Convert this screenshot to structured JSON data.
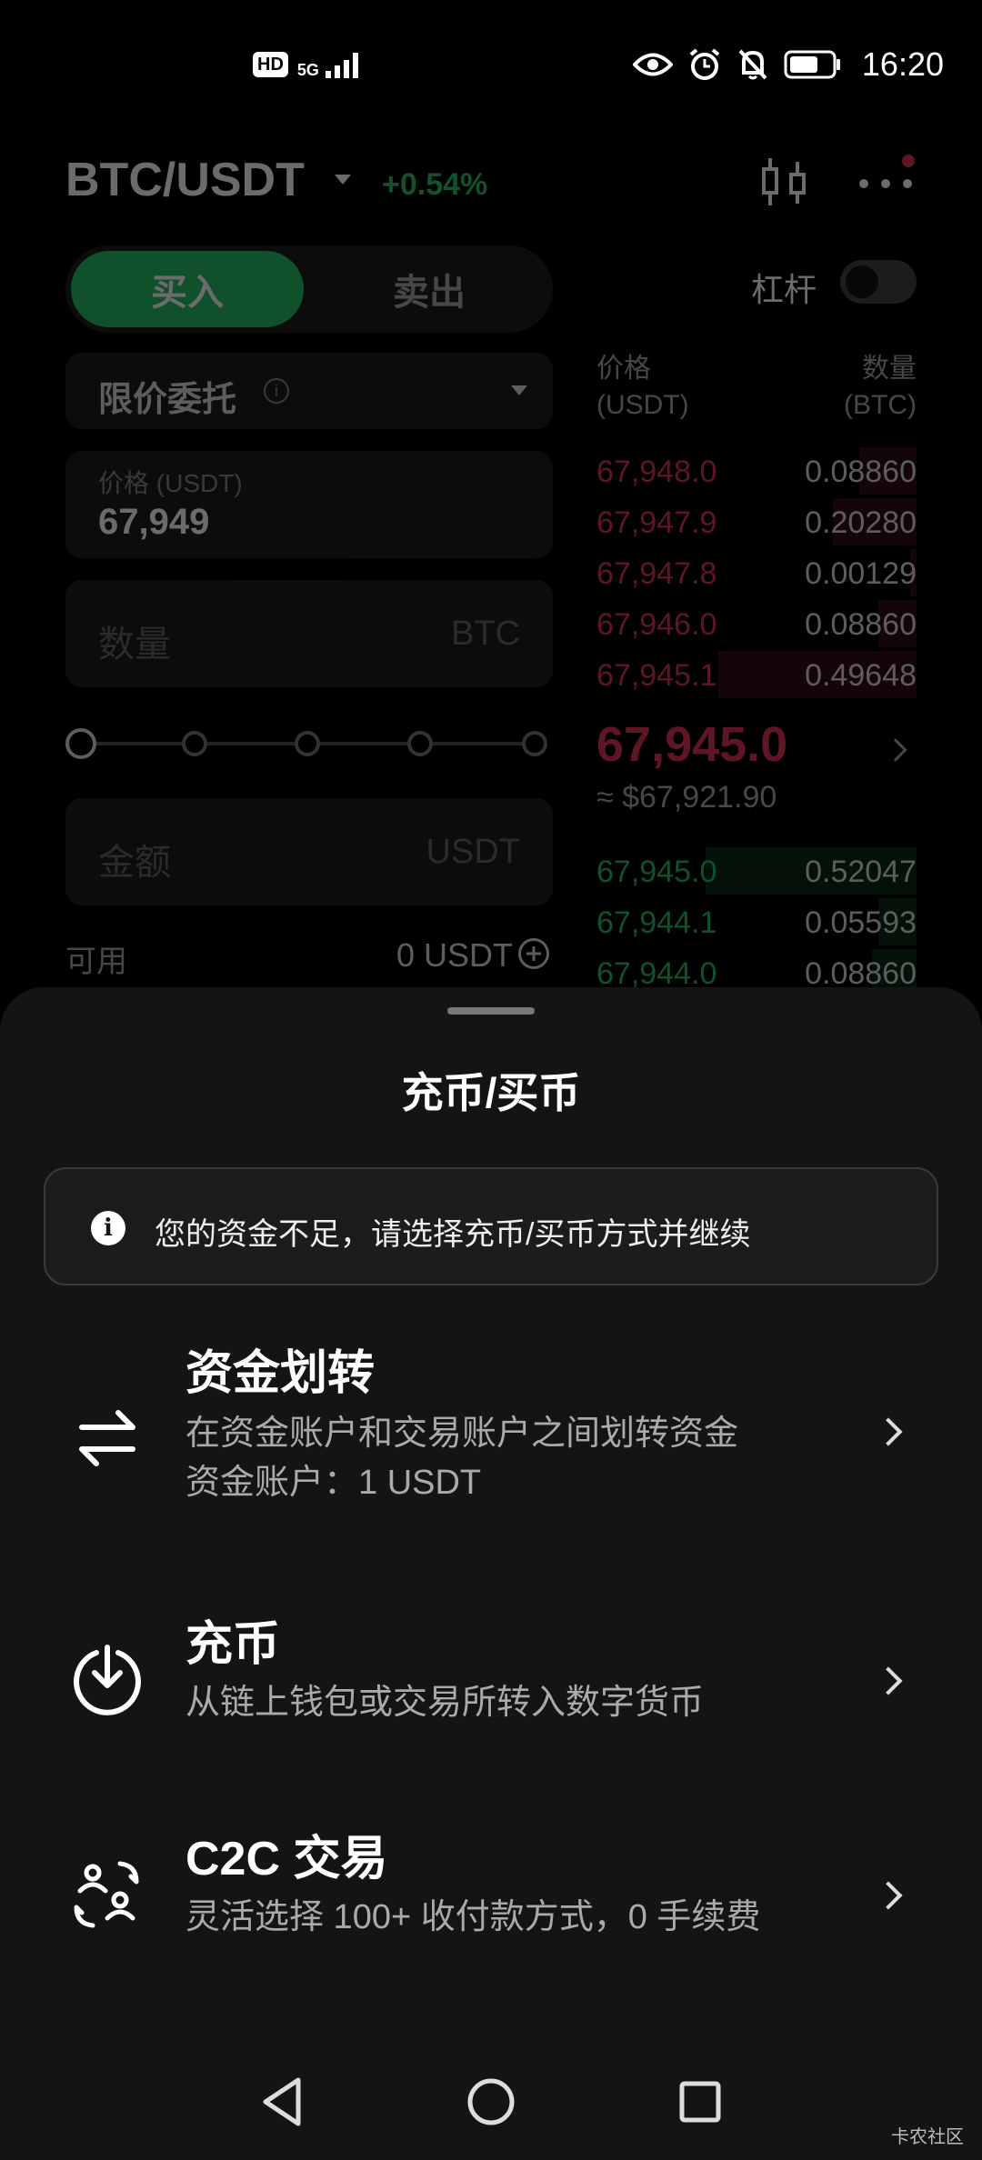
{
  "status_bar": {
    "hd": "HD",
    "network": "5G",
    "time": "16:20",
    "icons": [
      "eye-icon",
      "alarm-icon",
      "mute-bell-icon",
      "battery-icon"
    ]
  },
  "trading": {
    "pair": "BTC/USDT",
    "change": "+0.54%",
    "buy_label": "买入",
    "sell_label": "卖出",
    "leverage_label": "杠杆",
    "order_type": "限价委托",
    "price_label": "价格 (USDT)",
    "price_value": "67,949",
    "quantity_placeholder": "数量",
    "quantity_unit": "BTC",
    "amount_placeholder": "金额",
    "amount_unit": "USDT",
    "available_label": "可用",
    "available_value": "0 USDT",
    "orderbook": {
      "price_header": "价格",
      "price_header_unit": "(USDT)",
      "qty_header": "数量",
      "qty_header_unit": "(BTC)",
      "asks": [
        {
          "price": "67,948.0",
          "qty": "0.08860",
          "depth": 0.18
        },
        {
          "price": "67,947.9",
          "qty": "0.20280",
          "depth": 0.26
        },
        {
          "price": "67,947.8",
          "qty": "0.00129",
          "depth": 0.02
        },
        {
          "price": "67,946.0",
          "qty": "0.08860",
          "depth": 0.12
        },
        {
          "price": "67,945.1",
          "qty": "0.49648",
          "depth": 0.62
        }
      ],
      "last_price": "67,945.0",
      "last_price_usd": "≈ $67,921.90",
      "bids": [
        {
          "price": "67,945.0",
          "qty": "0.52047",
          "depth": 0.66
        },
        {
          "price": "67,944.1",
          "qty": "0.05593",
          "depth": 0.12
        },
        {
          "price": "67,944.0",
          "qty": "0.08860",
          "depth": 0.14
        }
      ]
    }
  },
  "sheet": {
    "title": "充币/买币",
    "notice": "您的资金不足，请选择充币/买币方式并继续",
    "options": [
      {
        "title": "资金划转",
        "desc": "在资金账户和交易账户之间划转资金",
        "desc2": "资金账户：1 USDT",
        "icon": "transfer-arrows-icon"
      },
      {
        "title": "充币",
        "desc": "从链上钱包或交易所转入数字货币",
        "icon": "deposit-download-icon"
      },
      {
        "title": "C2C 交易",
        "desc": "灵活选择 100+ 收付款方式，0 手续费",
        "icon": "c2c-exchange-icon"
      }
    ]
  },
  "watermark": "卡农社区",
  "colors": {
    "buy_green": "#26c168",
    "ask_red": "#e0355c",
    "sheet_bg": "#141414"
  }
}
